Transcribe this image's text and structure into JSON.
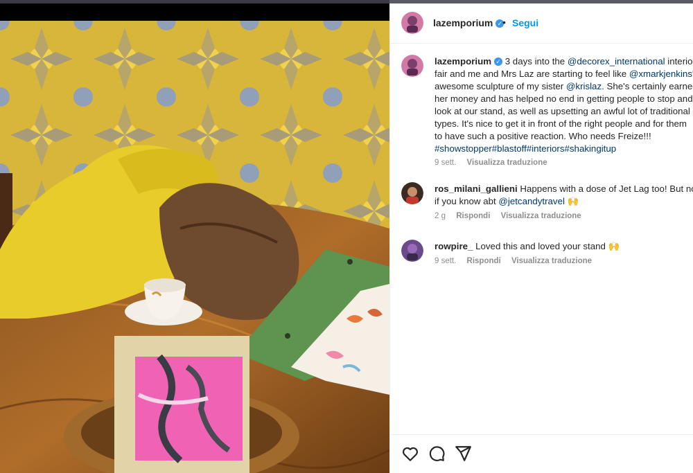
{
  "post": {
    "username": "lazemporium",
    "verified_glyph": "✓",
    "dot": "•",
    "follow_label": "Segui"
  },
  "caption": {
    "username": "lazemporium",
    "lines": [
      [
        {
          "t": " 3 days into the "
        },
        {
          "t": "@decorex_international",
          "m": true
        },
        {
          "t": " interiors"
        }
      ],
      [
        {
          "t": "fair and me and Mrs Laz are starting to feel like "
        },
        {
          "t": "@xmarkjenkins",
          "m": true
        },
        {
          "t": "'s"
        }
      ],
      [
        {
          "t": "awesome sculpture of my sister "
        },
        {
          "t": "@krislaz",
          "m": true
        },
        {
          "t": ". She's certainly earned"
        }
      ],
      [
        {
          "t": "her money and has helped no end in getting people to stop and"
        }
      ],
      [
        {
          "t": "look at our stand, as well as upsetting an awful lot of traditional"
        }
      ],
      [
        {
          "t": "types. It's nice to get it in front of the right people and for them"
        }
      ],
      [
        {
          "t": "to have such a positive reaction. Who needs Freize!!!"
        }
      ],
      [
        {
          "t": "#showstopper#blastoff#interiors#shakingitup",
          "m": true
        }
      ]
    ],
    "time": "9 sett.",
    "translate": "Visualizza traduzione"
  },
  "comments": [
    {
      "username": "ros_milani_gallieni",
      "lines": [
        [
          {
            "t": " Happens with a dose of Jet Lag too! But no"
          }
        ],
        [
          {
            "t": "if you know abt "
          },
          {
            "t": "@jetcandytravel",
            "m": true
          },
          {
            "t": " 🙌"
          }
        ]
      ],
      "time": "2 g",
      "reply": "Rispondi",
      "translate": "Visualizza traduzione"
    },
    {
      "username": "rowpire_",
      "lines": [
        [
          {
            "t": " Loved this and loved your stand 🙌"
          }
        ]
      ],
      "time": "9 sett.",
      "reply": "Rispondi",
      "translate": "Visualizza traduzione"
    }
  ],
  "actions": {
    "like_icon": "heart-icon",
    "comment_icon": "comment-icon",
    "share_icon": "send-icon"
  },
  "colors": {
    "link": "#0095f6",
    "mention": "#00376b",
    "meta": "#8e8e8e",
    "verified": "#3897f0"
  }
}
